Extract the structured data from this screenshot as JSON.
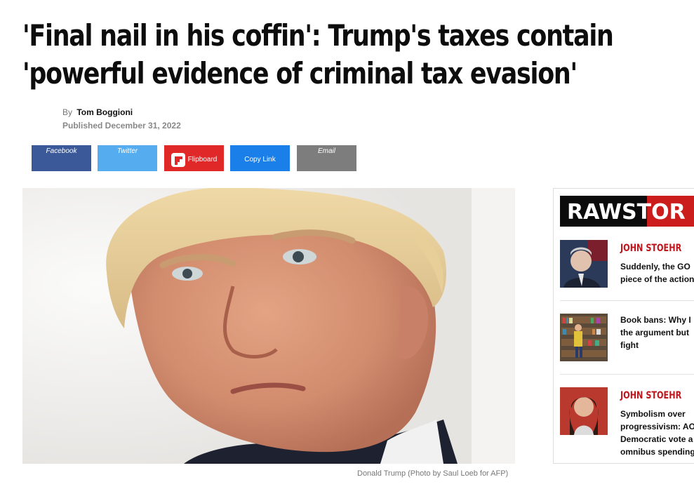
{
  "article": {
    "headline_line1": "'Final nail in his coffin': Trump's taxes contain",
    "headline_line2": "'powerful evidence of criminal tax evasion'",
    "by_label": "By",
    "author": "Tom Boggioni",
    "published": "Published December 31, 2022",
    "image_caption": "Donald Trump (Photo by Saul Loeb for AFP)"
  },
  "share": {
    "facebook": "Facebook",
    "twitter": "Twitter",
    "flipboard": "Flipboard",
    "copy_link": "Copy Link",
    "email": "Email"
  },
  "sidebar": {
    "logo_text": "RAWSTOR",
    "stories": [
      {
        "author": "JOHN STOEHR",
        "title_lines": [
          "Suddenly, the GO",
          "piece of the action"
        ]
      },
      {
        "author": "",
        "title_lines": [
          "Book bans: Why I",
          "the argument but",
          "fight"
        ]
      },
      {
        "author": "JOHN STOEHR",
        "title_lines": [
          "Symbolism over",
          "progressivism: AO",
          "Democratic vote a",
          "omnibus spending"
        ]
      }
    ]
  },
  "colors": {
    "facebook": "#3b5998",
    "twitter": "#55acee",
    "flipboard": "#e12828",
    "copy_link": "#1a7fe8",
    "email": "#7d7d7d",
    "accent_red": "#c0151b"
  }
}
